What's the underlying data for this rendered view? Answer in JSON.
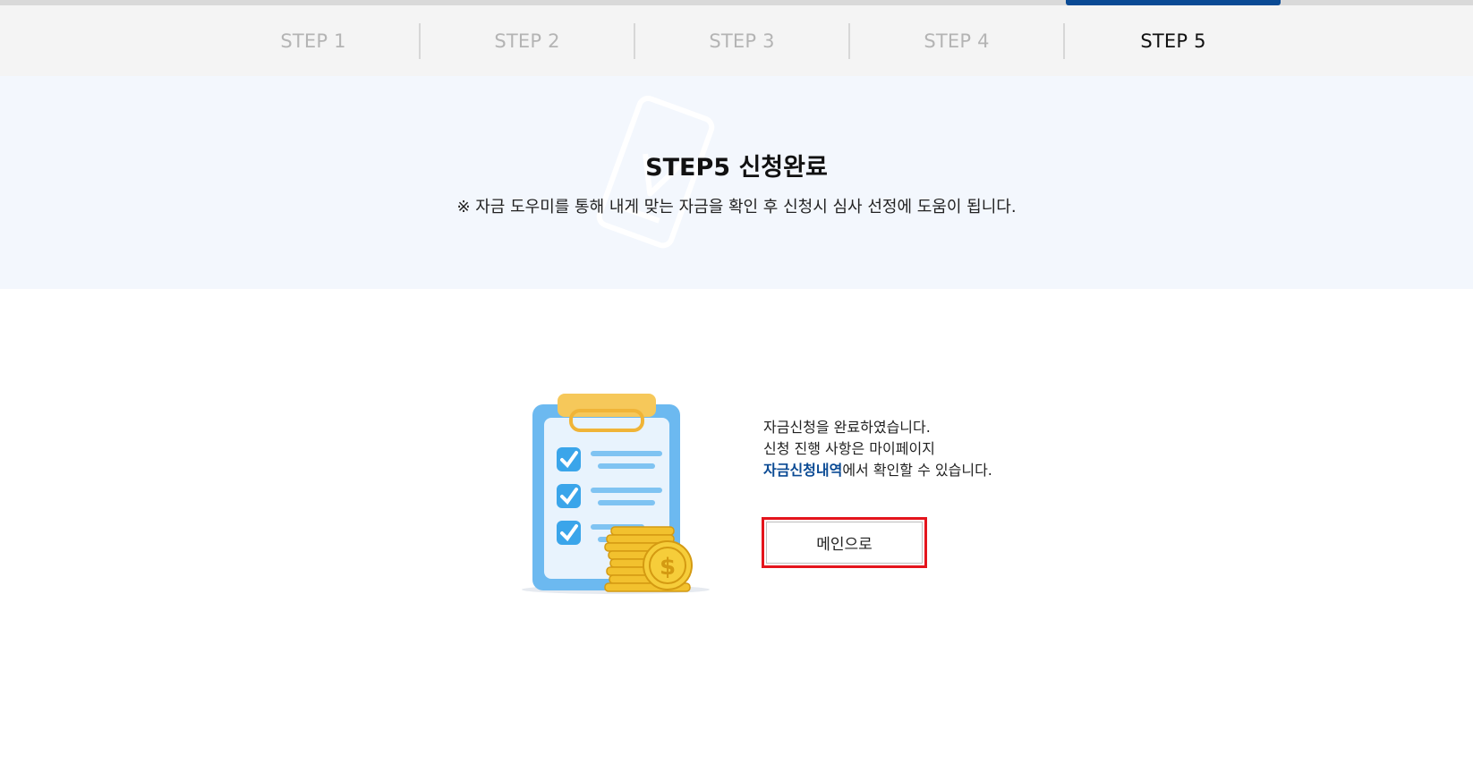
{
  "progress": {
    "current_step": 5,
    "total_steps": 5,
    "color": "#0a4a94"
  },
  "steps": [
    {
      "label": "STEP 1",
      "active": false
    },
    {
      "label": "STEP 2",
      "active": false
    },
    {
      "label": "STEP 3",
      "active": false
    },
    {
      "label": "STEP 4",
      "active": false
    },
    {
      "label": "STEP 5",
      "active": true
    }
  ],
  "hero": {
    "title": "STEP5 신청완료",
    "subtitle": "※ 자금 도우미를 통해 내게 맞는 자금을 확인 후 신청시 심사 선정에 도움이 됩니다."
  },
  "illustration": {
    "icon": "clipboard-checklist-coins-icon"
  },
  "message": {
    "line1": "자금신청을 완료하였습니다.",
    "line2": "신청 진행 사항은 마이페이지",
    "link_text": "자금신청내역",
    "line3_suffix": "에서 확인할 수 있습니다."
  },
  "buttons": {
    "main_label": "메인으로"
  },
  "colors": {
    "accent": "#0a4a94",
    "highlight_border": "#e4141c",
    "hero_bg": "#f3f7fd"
  }
}
